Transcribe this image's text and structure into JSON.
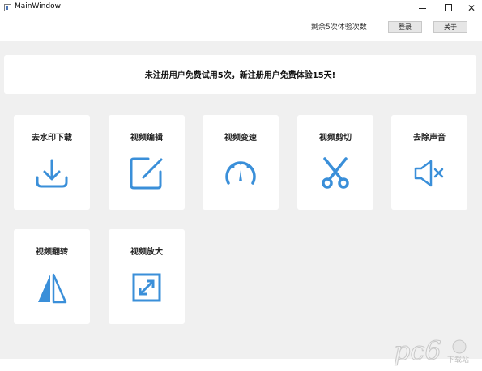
{
  "window": {
    "title": "MainWindow",
    "minimize": "–",
    "close": "✕"
  },
  "header": {
    "remaining_text": "剩余5次体验次数",
    "login_label": "登录",
    "about_label": "关于"
  },
  "notice": {
    "text": "未注册用户免费试用5次，新注册用户免费体验15天!"
  },
  "tools": [
    {
      "label": "去水印下载",
      "icon": "download-icon"
    },
    {
      "label": "视频编辑",
      "icon": "edit-icon"
    },
    {
      "label": "视频变速",
      "icon": "speedometer-icon"
    },
    {
      "label": "视频剪切",
      "icon": "scissors-icon"
    },
    {
      "label": "去除声音",
      "icon": "mute-icon"
    },
    {
      "label": "视频翻转",
      "icon": "flip-icon"
    },
    {
      "label": "视频放大",
      "icon": "expand-icon"
    }
  ],
  "colors": {
    "accent": "#3a8fd9",
    "background": "#f0f0f0",
    "card": "#ffffff"
  },
  "watermark": {
    "text": "pc6",
    "subtext": "下载站"
  }
}
